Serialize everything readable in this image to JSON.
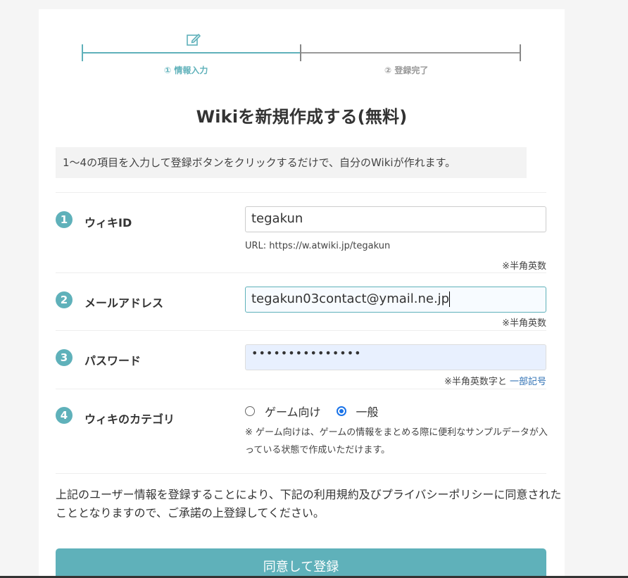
{
  "stepper": {
    "step1": "① 情報入力",
    "step2": "② 登録完了",
    "active_color": "#5fb1ba"
  },
  "page": {
    "title": "Wikiを新規作成する(無料)",
    "intro": "1〜4の項目を入力して登録ボタンをクリックするだけで、自分のWikiが作れます。"
  },
  "form": {
    "wiki_id": {
      "num": "1",
      "label": "ウィキID",
      "value": "tegakun",
      "url_hint": "URL: https://w.atwiki.jp/tegakun",
      "note": "※半角英数"
    },
    "email": {
      "num": "2",
      "label": "メールアドレス",
      "value": "tegakun03contact@ymail.ne.jp",
      "note": "※半角英数"
    },
    "password": {
      "num": "3",
      "label": "パスワード",
      "masked_value": "•••••••••••••••",
      "note_prefix": "※半角英数字と",
      "note_link": "一部記号"
    },
    "category": {
      "num": "4",
      "label": "ウィキのカテゴリ",
      "option_game": "ゲーム向け",
      "option_general": "一般",
      "selected": "一般",
      "help": "※ ゲーム向けは、ゲームの情報をまとめる際に便利なサンプルデータが入っている状態で作成いただけます。"
    }
  },
  "agreement": "上記のユーザー情報を登録することにより、下記の利用規約及びプライバシーポリシーに同意されたこととなりますので、ご承諾の上登録してください。",
  "submit_label": "同意して登録"
}
